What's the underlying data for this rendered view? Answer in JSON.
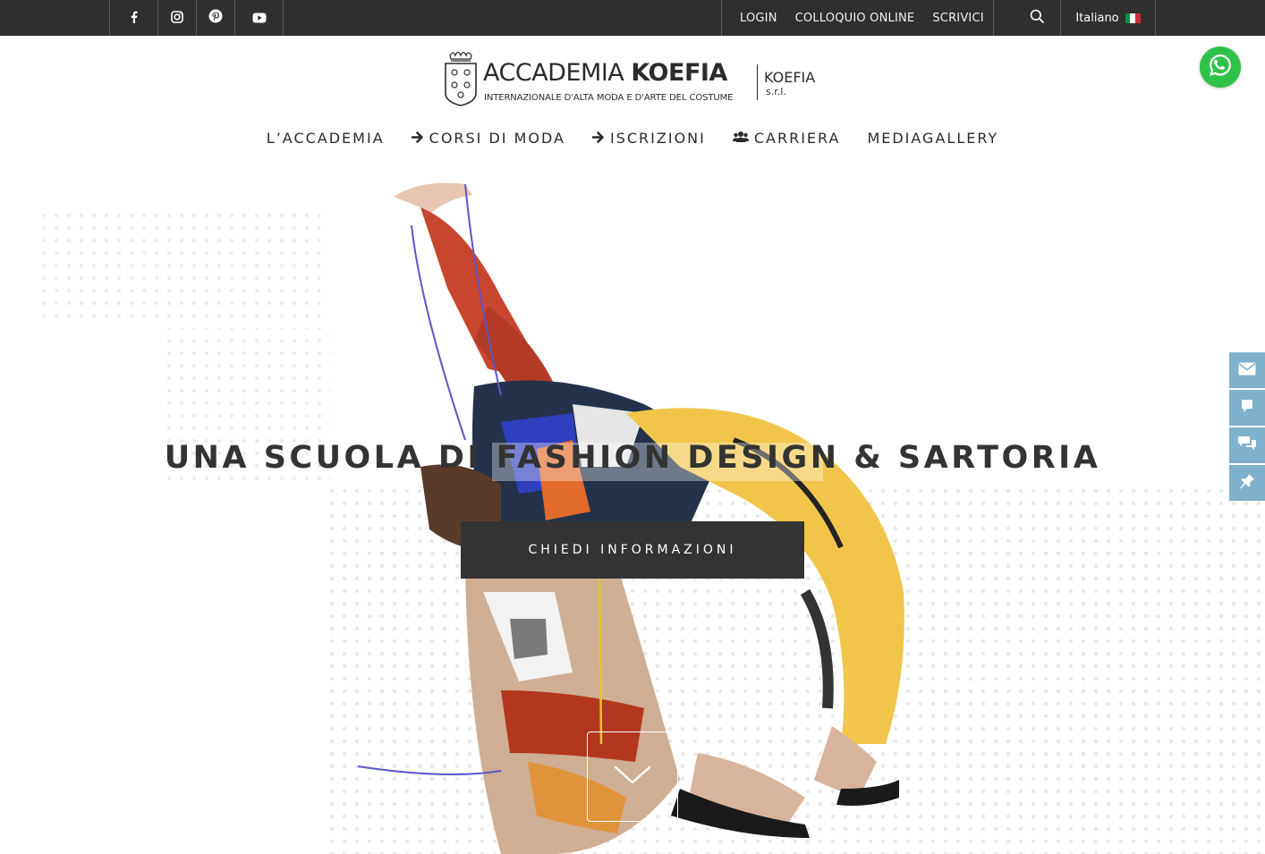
{
  "topbar": {
    "social": [
      {
        "icon": "facebook-icon"
      },
      {
        "icon": "instagram-icon"
      },
      {
        "icon": "pinterest-icon"
      },
      {
        "icon": "youtube-icon"
      }
    ],
    "links": [
      "LOGIN",
      "COLLOQUIO ONLINE",
      "SCRIVICI"
    ],
    "language": "Italiano",
    "colors": {
      "background": "#2f2f2f",
      "flag": [
        "#009246",
        "#ffffff",
        "#ce2b37"
      ]
    }
  },
  "logo": {
    "main_prefix": "ACCADEMIA",
    "main_bold": "KOEFIA",
    "subtitle": "INTERNAZIONALE D'ALTA MODA E D'ARTE DEL COSTUME",
    "right": "KOEFIA",
    "srl": "s.r.l."
  },
  "nav": {
    "items": [
      {
        "label": "L’ACCADEMIA",
        "icon": ""
      },
      {
        "label": "CORSI DI MODA",
        "icon": "arrow-right-icon"
      },
      {
        "label": "ISCRIZIONI",
        "icon": "arrow-right-icon"
      },
      {
        "label": "CARRIERA",
        "icon": "users-icon"
      },
      {
        "label": "MEDIAGALLERY",
        "icon": ""
      }
    ]
  },
  "hero": {
    "title": "UNA SCUOLA DI FASHION DESIGN & SARTORIA",
    "cta": "CHIEDI INFORMAZIONI",
    "scroll_icon": "chevron-down-icon"
  },
  "whatsapp": {
    "icon": "whatsapp-icon",
    "color": "#2fc24a"
  },
  "sidedock": {
    "color": "#7fb0cc",
    "items": [
      "envelope-icon",
      "comment-icon",
      "comments-icon",
      "pin-icon"
    ]
  }
}
